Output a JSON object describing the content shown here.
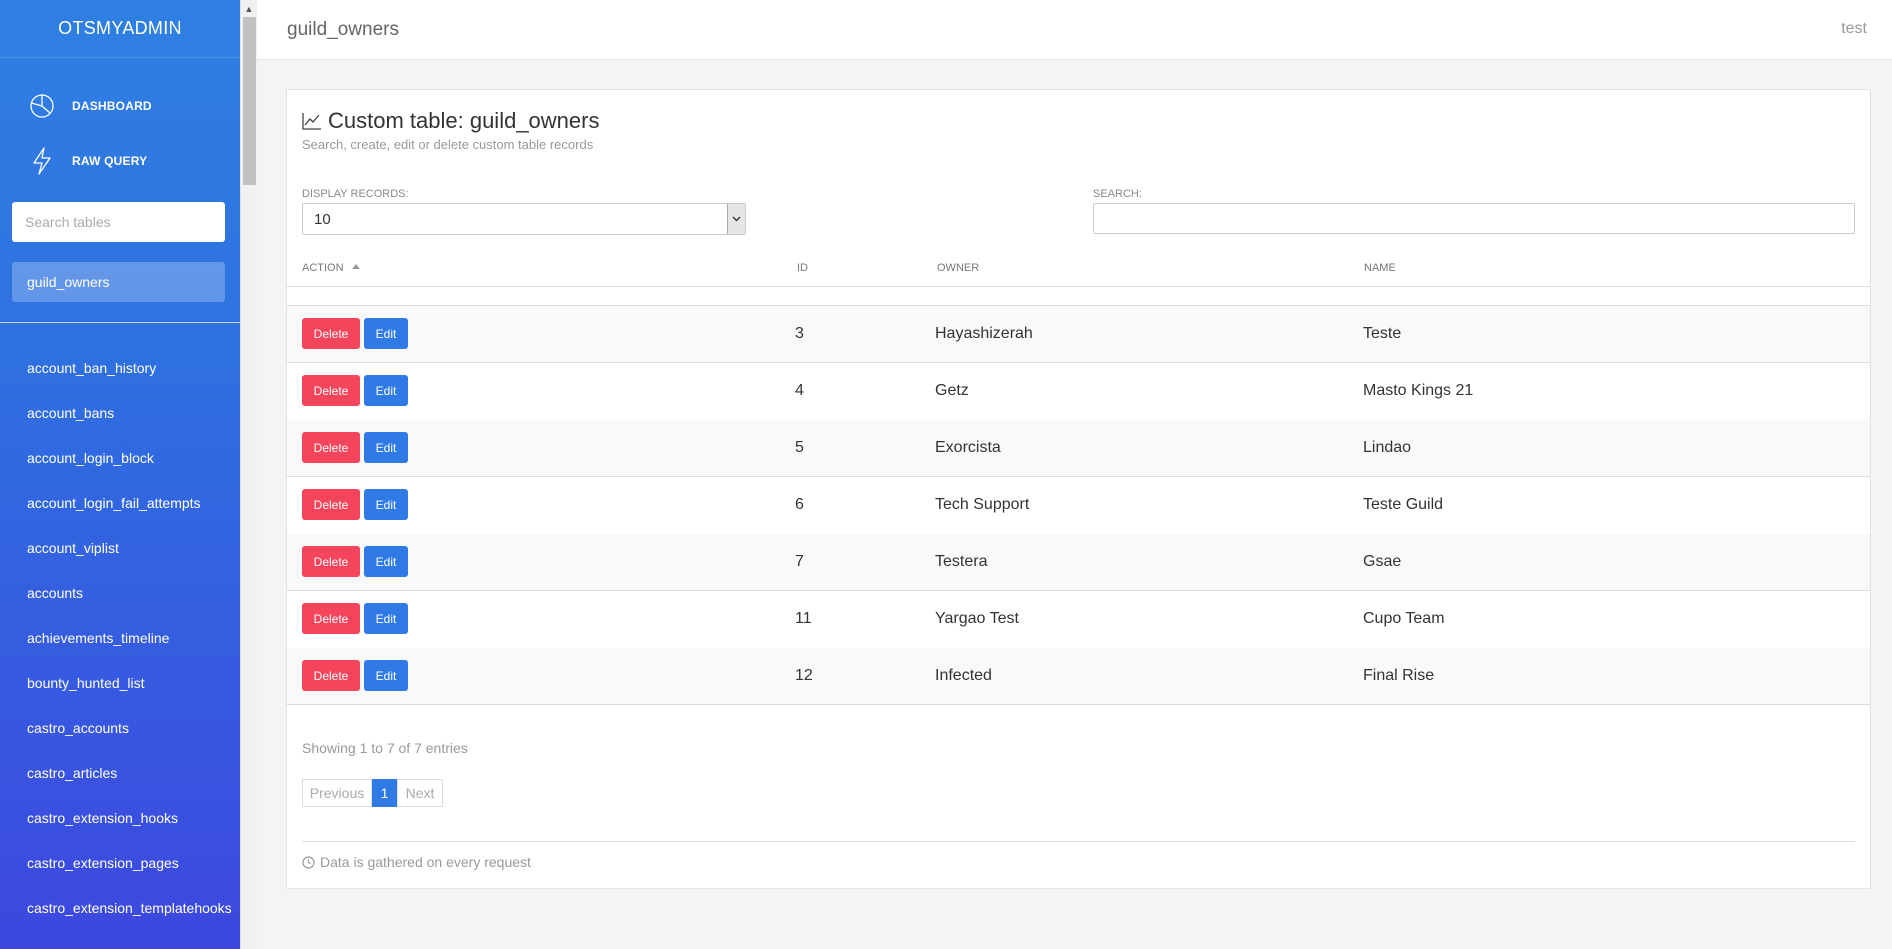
{
  "sidebar": {
    "brand": "OTSMYADMIN",
    "nav": [
      {
        "label": "DASHBOARD",
        "icon": "pie-chart-icon"
      },
      {
        "label": "RAW QUERY",
        "icon": "lightning-icon"
      }
    ],
    "search_placeholder": "Search tables",
    "active_table": "guild_owners",
    "tables": [
      "account_ban_history",
      "account_bans",
      "account_login_block",
      "account_login_fail_attempts",
      "account_viplist",
      "accounts",
      "achievements_timeline",
      "bounty_hunted_list",
      "castro_accounts",
      "castro_articles",
      "castro_extension_hooks",
      "castro_extension_pages",
      "castro_extension_templatehooks"
    ]
  },
  "topbar": {
    "title": "guild_owners",
    "user": "test"
  },
  "card": {
    "title": "Custom table: guild_owners",
    "subtitle": "Search, create, edit or delete custom table records",
    "display_label": "DISPLAY RECORDS:",
    "display_value": "10",
    "search_label": "SEARCH:",
    "search_value": ""
  },
  "table": {
    "headers": {
      "action": "ACTION",
      "id": "ID",
      "owner": "OWNER",
      "name": "NAME"
    },
    "delete_label": "Delete",
    "edit_label": "Edit",
    "rows": [
      {
        "id": "3",
        "owner": "Hayashizerah",
        "name": "Teste"
      },
      {
        "id": "4",
        "owner": "Getz",
        "name": "Masto Kings 21"
      },
      {
        "id": "5",
        "owner": "Exorcista",
        "name": "Lindao"
      },
      {
        "id": "6",
        "owner": "Tech Support",
        "name": "Teste Guild"
      },
      {
        "id": "7",
        "owner": "Testera",
        "name": "Gsae"
      },
      {
        "id": "11",
        "owner": "Yargao Test",
        "name": "Cupo Team"
      },
      {
        "id": "12",
        "owner": "Infected",
        "name": "Final Rise"
      }
    ]
  },
  "footer": {
    "info": "Showing 1 to 7 of 7 entries",
    "prev": "Previous",
    "page": "1",
    "next": "Next",
    "note": "Data is gathered on every request"
  },
  "colors": {
    "delete": "#f5455c",
    "edit": "#2f7ae5",
    "sidebar_top": "#2f80e2",
    "sidebar_bottom": "#3d47df"
  }
}
